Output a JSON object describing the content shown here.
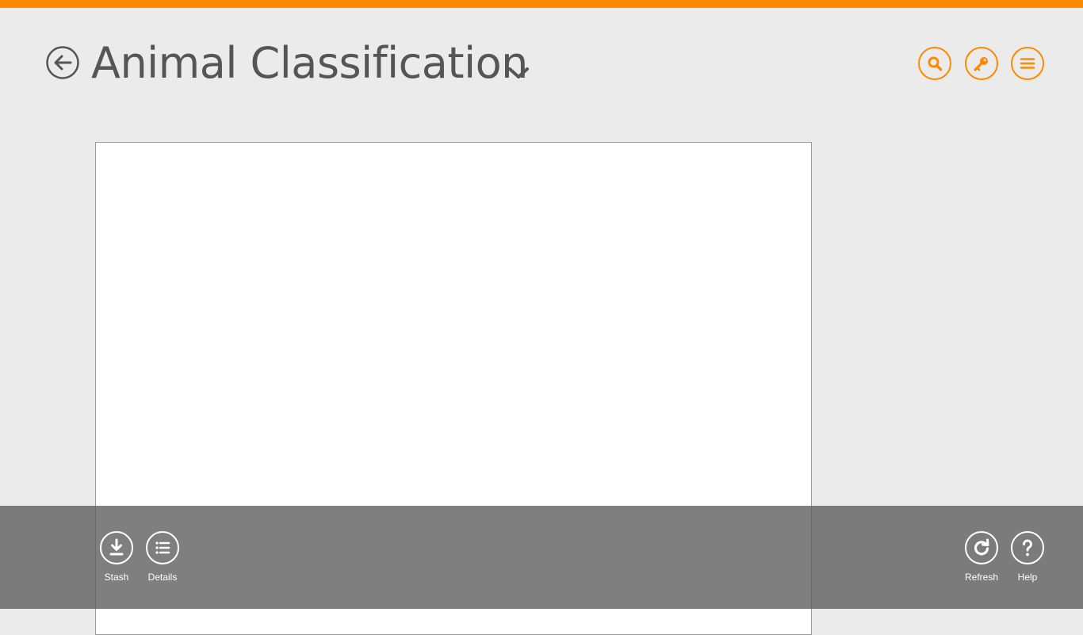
{
  "header": {
    "title": "Animal Classification",
    "accent_color": "#ff8a00",
    "back_icon": "back-arrow-icon",
    "dropdown_icon": "chevron-down-icon",
    "actions": [
      {
        "name": "search",
        "icon": "search-icon"
      },
      {
        "name": "key",
        "icon": "key-icon"
      },
      {
        "name": "menu",
        "icon": "hamburger-menu-icon"
      }
    ]
  },
  "app_bar": {
    "left_commands": [
      {
        "label": "Stash",
        "icon": "download-icon"
      },
      {
        "label": "Details",
        "icon": "list-icon"
      }
    ],
    "right_commands": [
      {
        "label": "Refresh",
        "icon": "refresh-icon"
      },
      {
        "label": "Help",
        "icon": "help-icon"
      }
    ]
  }
}
